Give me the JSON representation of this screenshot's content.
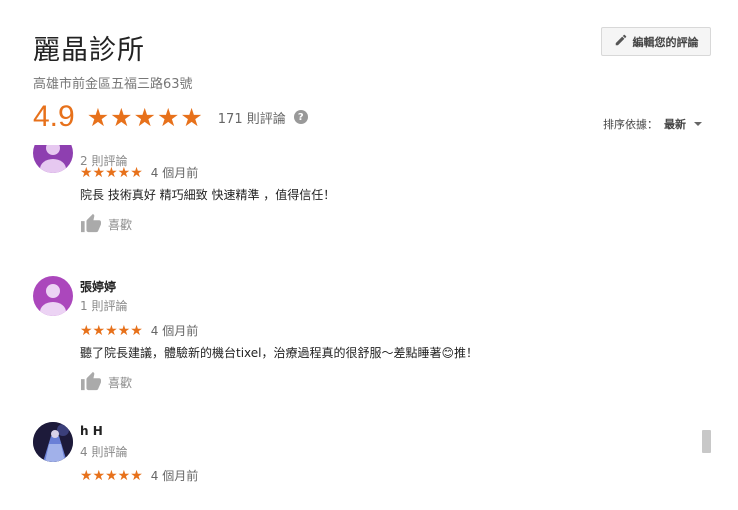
{
  "place": {
    "name": "麗晶診所",
    "address": "高雄市前金區五福三路63號",
    "rating": "4.9",
    "stars": "★★★★★",
    "review_count": "171 則評論",
    "help": "?"
  },
  "toolbar": {
    "edit_label": "編輯您的評論"
  },
  "sort": {
    "label": "排序依據：",
    "value": "最新"
  },
  "reviews": [
    {
      "name": "",
      "count": "2 則評論",
      "stars": "★★★★★",
      "time": "4 個月前",
      "text": "院長 技術真好 精巧細致 快速精準 ，值得信任！",
      "like": "喜歡",
      "avatar_color": "#8e3fb0"
    },
    {
      "name": "張婷婷",
      "count": "1 則評論",
      "stars": "★★★★★",
      "time": "4 個月前",
      "text": "聽了院長建議，體驗新的機台tixel，治療過程真的很舒服～差點睡著😊推！",
      "like": "喜歡",
      "avatar_color": "#ab47bc"
    },
    {
      "name": "h H",
      "count": "4 則評論",
      "stars": "★★★★★",
      "time": "4 個月前",
      "avatar_color": "#1d1a3a"
    }
  ],
  "colors": {
    "accent": "#e7711b"
  }
}
